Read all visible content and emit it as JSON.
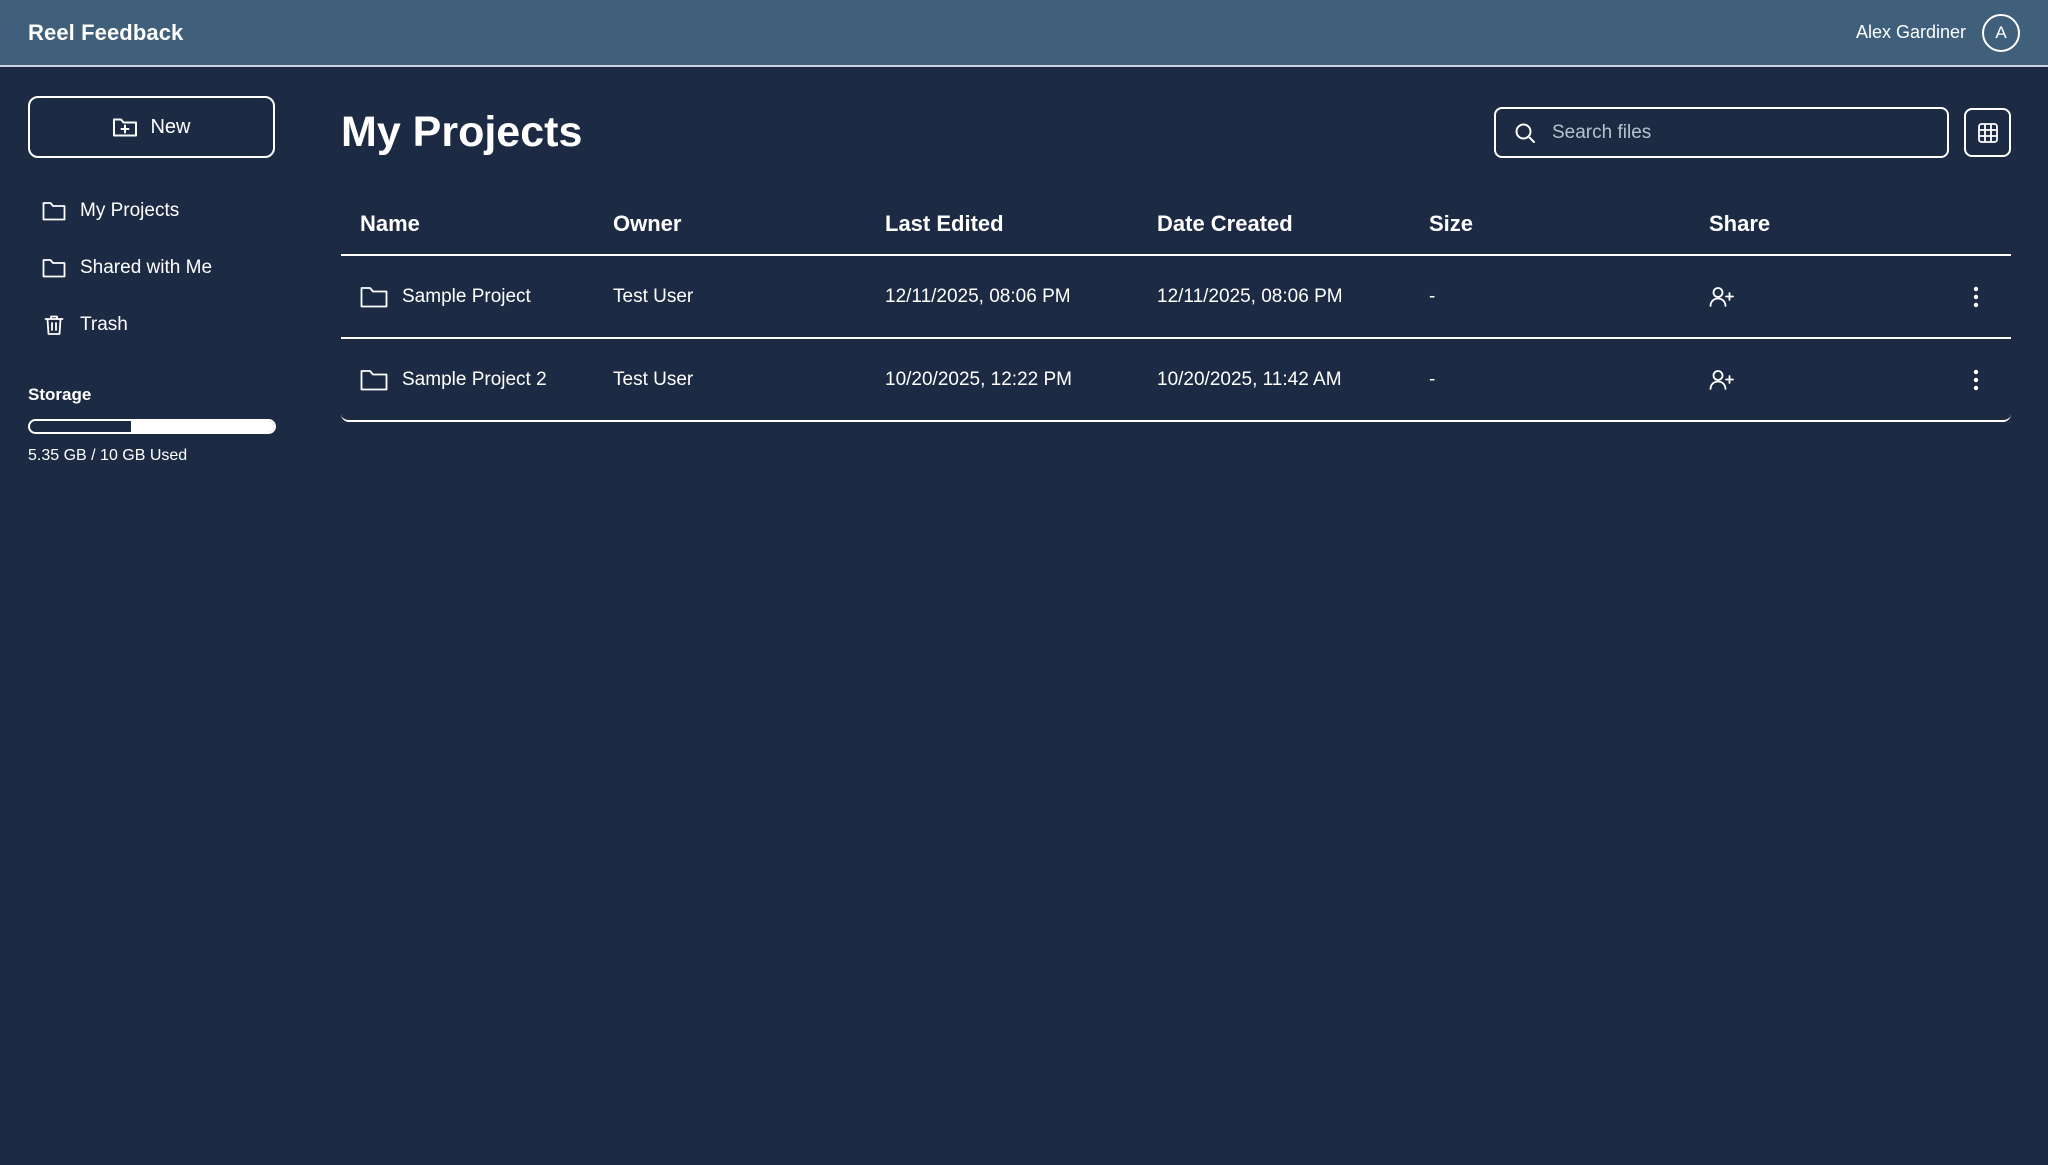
{
  "header": {
    "app_title": "Reel Feedback",
    "user_name": "Alex Gardiner",
    "avatar_initial": "A"
  },
  "sidebar": {
    "new_label": "New",
    "items": [
      {
        "label": "My Projects",
        "icon": "folder-icon"
      },
      {
        "label": "Shared with Me",
        "icon": "folder-icon"
      },
      {
        "label": "Trash",
        "icon": "trash-icon"
      }
    ],
    "storage": {
      "label": "Storage",
      "used_gb": 5.35,
      "total_gb": 10,
      "text": "5.35 GB / 10 GB Used"
    }
  },
  "main": {
    "title": "My Projects",
    "search_placeholder": "Search files",
    "columns": [
      "Name",
      "Owner",
      "Last Edited",
      "Date Created",
      "Size",
      "Share"
    ],
    "rows": [
      {
        "name": "Sample Project",
        "owner": "Test User",
        "last_edited": "12/11/2025, 08:06 PM",
        "date_created": "12/11/2025, 08:06 PM",
        "size": "-"
      },
      {
        "name": "Sample Project 2",
        "owner": "Test User",
        "last_edited": "10/20/2025, 12:22 PM",
        "date_created": "10/20/2025, 11:42 AM",
        "size": "-"
      }
    ]
  },
  "colors": {
    "background": "#1c2b43",
    "header": "#3f5f7a",
    "foreground": "#ffffff"
  }
}
